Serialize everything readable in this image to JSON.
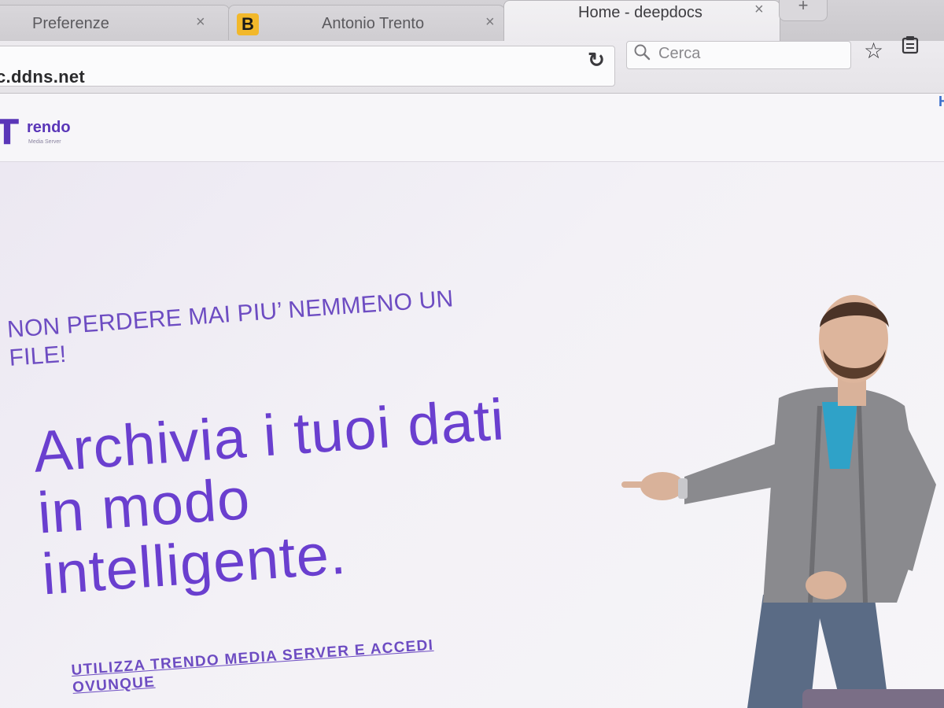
{
  "browser": {
    "tabs": [
      {
        "title": "Preferenze",
        "active": false
      },
      {
        "title": "B",
        "favicon_only": true,
        "active": false
      },
      {
        "title": "Antonio Trento",
        "active": false
      },
      {
        "title": "Home - deepdocs",
        "active": true
      }
    ],
    "new_tab_label": "+",
    "close_glyph": "×",
    "url": "c.ddns.net",
    "reload_glyph": "↻",
    "search_placeholder": "Cerca",
    "star_glyph": "☆"
  },
  "site": {
    "logo": {
      "mark": "T",
      "word": "rendo",
      "sub": "Media Server"
    },
    "header_link": "H"
  },
  "hero": {
    "kicker": "NON PERDERE MAI PIU’ NEMMENO UN FILE!",
    "title": "Archivia i tuoi dati in modo intelligente.",
    "cta": "UTILIZZA TRENDO MEDIA SERVER E ACCEDI OVUNQUE"
  },
  "colors": {
    "brand_purple": "#6a3fcf",
    "link_blue": "#3a6fcc",
    "chrome_gray": "#d4d2d6"
  },
  "icons": [
    "reload-icon",
    "search-icon",
    "star-icon",
    "reader-list-icon",
    "close-icon"
  ]
}
